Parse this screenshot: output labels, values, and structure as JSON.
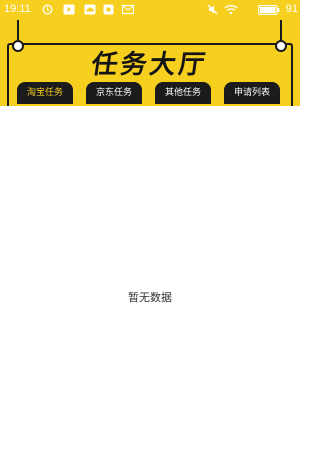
{
  "status_bar": {
    "time": "19:11",
    "battery": "91",
    "icons": [
      "alarm-icon",
      "video-icon",
      "cloud-icon",
      "app-icon",
      "envelope-icon",
      "mute-icon",
      "wifi-icon",
      "battery-icon"
    ]
  },
  "header": {
    "title": "任务大厅"
  },
  "tabs": [
    {
      "label": "淘宝任务",
      "active": true
    },
    {
      "label": "京东任务",
      "active": false
    },
    {
      "label": "其他任务",
      "active": false
    },
    {
      "label": "申请列表",
      "active": false
    }
  ],
  "content": {
    "empty_message": "暂无数据"
  },
  "colors": {
    "brand_yellow": "#f7cf1f",
    "tab_bg": "#1b1b1b",
    "active_tab_text": "#f7cf1f"
  }
}
